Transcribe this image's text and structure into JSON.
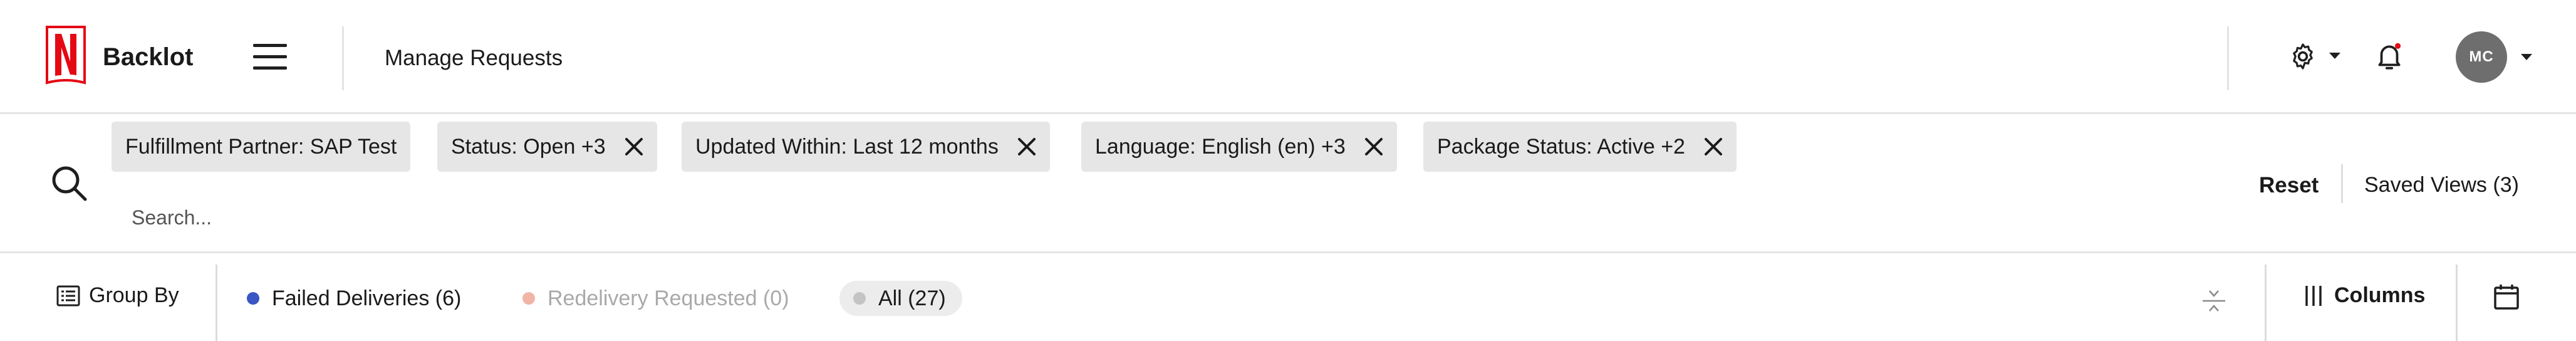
{
  "header": {
    "brand": "Backlot",
    "page_title": "Manage Requests",
    "avatar_initials": "MC",
    "logo_letter": "N",
    "icons": {
      "menu": "hamburger-menu-icon",
      "settings": "gear-icon",
      "notifications": "bell-icon"
    },
    "colors": {
      "logo_red": "#e50914",
      "notification_dot": "#e50914"
    }
  },
  "filters": {
    "chips": [
      {
        "label": "Fulfillment Partner: SAP Test",
        "removable": false
      },
      {
        "label": "Status: Open +3",
        "removable": true
      },
      {
        "label": "Updated Within: Last 12 months",
        "removable": true
      },
      {
        "label": "Language: English (en) +3",
        "removable": true
      },
      {
        "label": "Package Status: Active +2",
        "removable": true
      }
    ],
    "search_placeholder": "Search...",
    "reset_label": "Reset",
    "saved_views_label": "Saved Views (3)"
  },
  "toolbar": {
    "group_by_label": "Group By",
    "tabs": [
      {
        "label": "Failed Deliveries (6)",
        "dot_color": "#3a56c5",
        "text_color": "#1a1a1a",
        "active": false
      },
      {
        "label": "Redelivery Requested (0)",
        "dot_color": "#f0b5a6",
        "text_color": "#a9a9a9",
        "active": false
      },
      {
        "label": "All (27)",
        "dot_color": "#c4c4c4",
        "text_color": "#1a1a1a",
        "active": true
      }
    ],
    "columns_label": "Columns"
  }
}
